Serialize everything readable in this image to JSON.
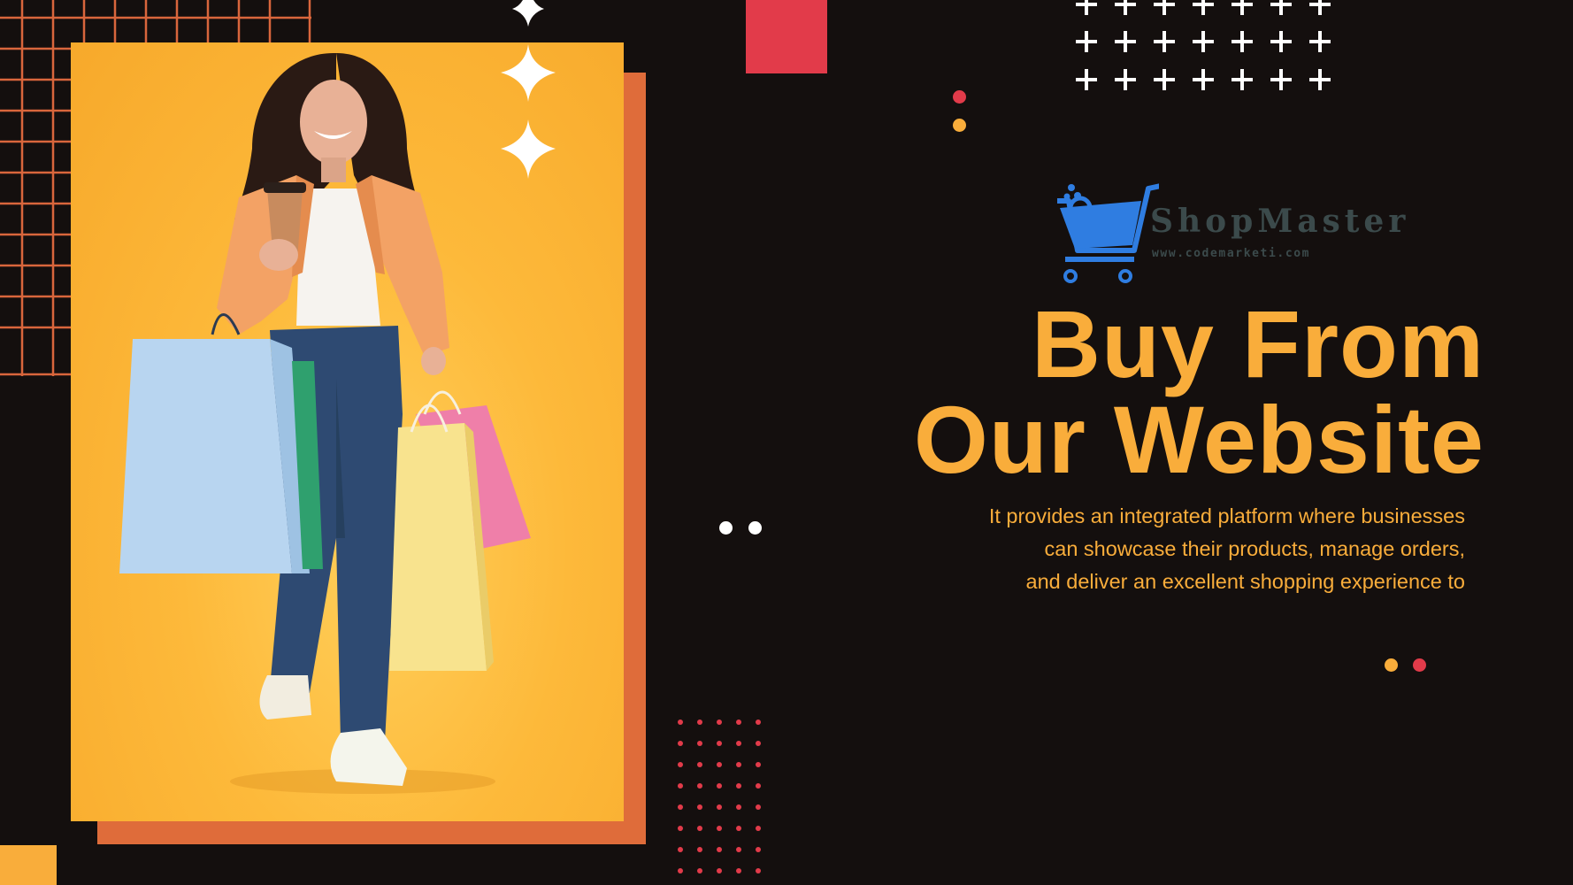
{
  "brand": {
    "name": "ShopMaster",
    "url": "www.codemarketi.com",
    "icon": "shopping-cart-icon",
    "logo_color": "#2f7de1"
  },
  "headline": {
    "line1": "Buy From",
    "line2": "Our Website"
  },
  "description": {
    "line1": "It provides an integrated platform where businesses",
    "line2": "can showcase their products, manage orders,",
    "line3": "and deliver an excellent shopping experience to"
  },
  "photo": {
    "subject": "woman-with-shopping-bags"
  },
  "colors": {
    "background": "#140f0e",
    "accent_yellow": "#f9ad3b",
    "accent_orange": "#df6c3a",
    "accent_red": "#e23b4a",
    "white": "#ffffff"
  }
}
